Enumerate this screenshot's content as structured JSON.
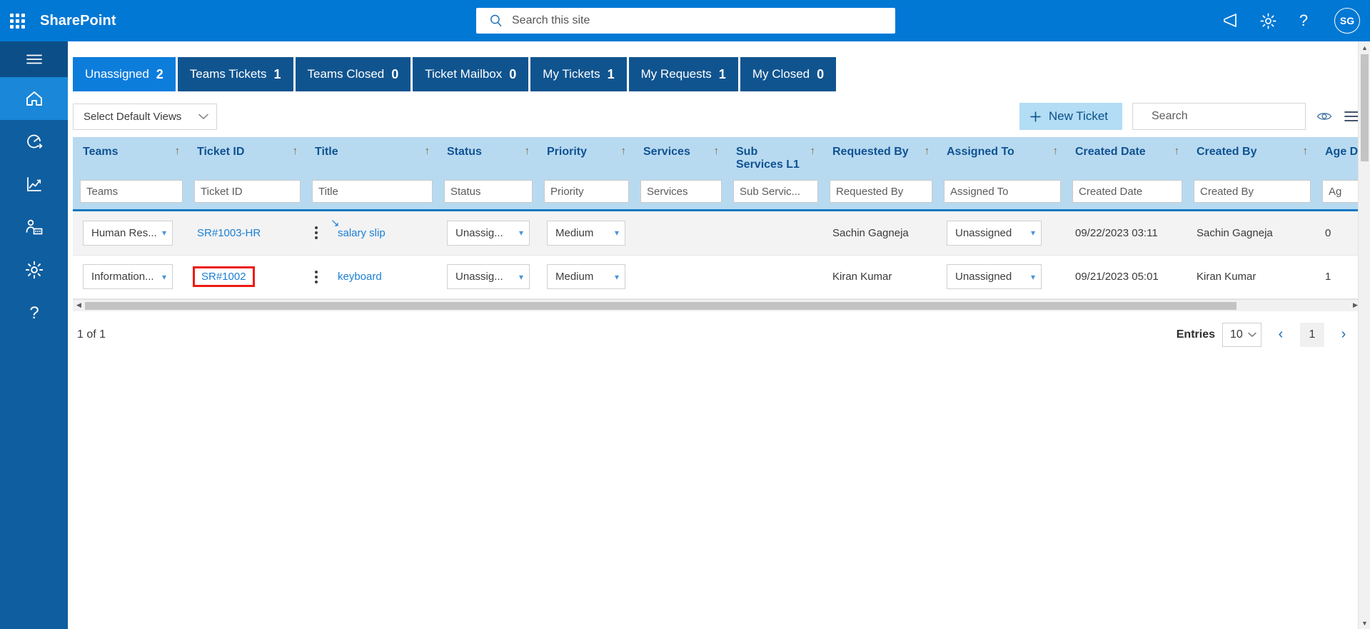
{
  "suitebar": {
    "waffle_name": "app-launcher",
    "brand": "SharePoint",
    "search_placeholder": "Search this site",
    "megaphone_icon": "megaphone-icon",
    "settings_icon": "gear-icon",
    "help_icon": "help-icon",
    "avatar_initials": "SG",
    "brand_bg": "#0078d4"
  },
  "rail": {
    "items": [
      {
        "name": "hamburger-menu",
        "active": false
      },
      {
        "name": "home",
        "active": true
      },
      {
        "name": "dashboard",
        "active": false
      },
      {
        "name": "reports",
        "active": false
      },
      {
        "name": "admin-users",
        "active": false
      },
      {
        "name": "settings",
        "active": false
      },
      {
        "name": "help",
        "active": false
      }
    ],
    "bg": "#0f5ea0",
    "active_bg": "#1a87d8"
  },
  "tabs": [
    {
      "label": "Unassigned",
      "count": "2",
      "active": true
    },
    {
      "label": "Teams Tickets",
      "count": "1",
      "active": false
    },
    {
      "label": "Teams Closed",
      "count": "0",
      "active": false
    },
    {
      "label": "Ticket Mailbox",
      "count": "0",
      "active": false
    },
    {
      "label": "My Tickets",
      "count": "1",
      "active": false
    },
    {
      "label": "My Requests",
      "count": "1",
      "active": false
    },
    {
      "label": "My Closed",
      "count": "0",
      "active": false
    }
  ],
  "toolbar": {
    "views_label": "Select Default Views",
    "new_ticket_label": "New Ticket",
    "new_ticket_bg": "#b3dcf5",
    "search_placeholder": "Search",
    "preview_icon": "eye-icon",
    "menu_icon": "list-menu-icon"
  },
  "grid": {
    "header_bg": "#b8daf0",
    "header_color": "#0f5293",
    "columns": [
      {
        "label": "Teams",
        "sort": "↑",
        "filter_placeholder": "Teams"
      },
      {
        "label": "Ticket ID",
        "sort": "↑",
        "filter_placeholder": "Ticket ID"
      },
      {
        "label": "Title",
        "sort": "↑",
        "filter_placeholder": "Title"
      },
      {
        "label": "Status",
        "sort": "↑",
        "filter_placeholder": "Status"
      },
      {
        "label": "Priority",
        "sort": "↑",
        "filter_placeholder": "Priority"
      },
      {
        "label": "Services",
        "sort": "↑",
        "filter_placeholder": "Services"
      },
      {
        "label": "Sub Services L1",
        "sort": "↑",
        "filter_placeholder": "Sub Servic..."
      },
      {
        "label": "Requested By",
        "sort": "↑",
        "filter_placeholder": "Requested By"
      },
      {
        "label": "Assigned To",
        "sort": "↑",
        "filter_placeholder": "Assigned To"
      },
      {
        "label": "Created Date",
        "sort": "↑",
        "filter_placeholder": "Created Date"
      },
      {
        "label": "Created By",
        "sort": "↑",
        "filter_placeholder": "Created By"
      },
      {
        "label": "Age D",
        "sort": "↑",
        "filter_placeholder": "Ag"
      }
    ],
    "rows": [
      {
        "teams": "Human Res...",
        "ticket_id": "SR#1003-HR",
        "ticket_id_annotated": false,
        "title": "salary slip",
        "status": "Unassig...",
        "priority": "Medium",
        "services": "",
        "sub_services": "",
        "requested_by": "Sachin Gagneja",
        "assigned_to": "Unassigned",
        "created_date": "09/22/2023 03:11",
        "created_by": "Sachin Gagneja",
        "age": "0"
      },
      {
        "teams": "Information...",
        "ticket_id": "SR#1002",
        "ticket_id_annotated": true,
        "title": "keyboard",
        "status": "Unassig...",
        "priority": "Medium",
        "services": "",
        "sub_services": "",
        "requested_by": "Kiran Kumar",
        "assigned_to": "Unassigned",
        "created_date": "09/21/2023 05:01",
        "created_by": "Kiran Kumar",
        "age": "1"
      }
    ],
    "annotation_color": "#ee1b11"
  },
  "footer": {
    "page_count": "1 of 1",
    "entries_label": "Entries",
    "entries_value": "10",
    "prev_label": "‹",
    "current_page": "1",
    "next_label": "›"
  }
}
